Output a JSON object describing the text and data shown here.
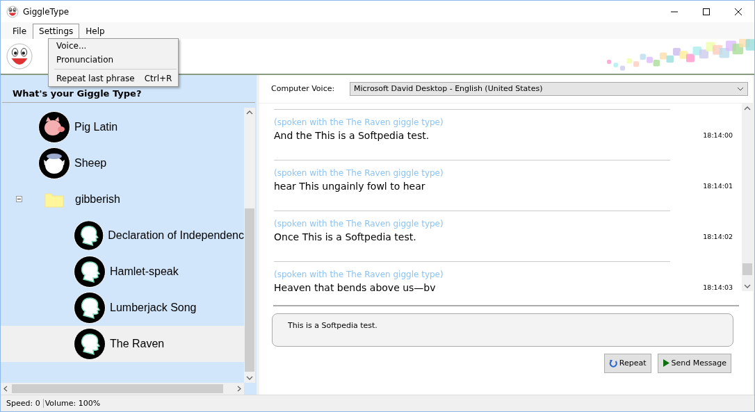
{
  "window": {
    "title": "GiggleType"
  },
  "menu": [
    {
      "label": "File",
      "selected": false
    },
    {
      "label": "Settings",
      "selected": true
    },
    {
      "label": "Help",
      "selected": false
    }
  ],
  "open_menu": [
    {
      "kind": "item",
      "label": "Voice..."
    },
    {
      "kind": "item",
      "label": "Pronunciation"
    },
    {
      "kind": "separator"
    },
    {
      "kind": "item",
      "label": "Repeat last phrase",
      "shortcut": "Ctrl+R"
    }
  ],
  "sidebar": {
    "heading": "What's your Giggle Type?",
    "tree": [
      {
        "kind": "pig",
        "label": "Pig Latin",
        "selected": false
      },
      {
        "kind": "sheep",
        "label": "Sheep",
        "selected": false
      },
      {
        "kind": "folder",
        "label": "gibberish",
        "selected": false,
        "expanded": true,
        "children": [
          {
            "kind": "head",
            "label": "Declaration of Independenc",
            "selected": false
          },
          {
            "kind": "head",
            "label": "Hamlet-speak",
            "selected": false
          },
          {
            "kind": "head",
            "label": "Lumberjack Song",
            "selected": false
          },
          {
            "kind": "head",
            "label": "The Raven",
            "selected": true
          }
        ]
      }
    ]
  },
  "voice": {
    "label": "Computer Voice:",
    "value": "Microsoft David Desktop - English (United States)"
  },
  "messages": [
    {
      "note": "(spoken with the The Raven giggle type)",
      "text": "And the This is a Softpedia test.",
      "time": "18:14:00"
    },
    {
      "note": "(spoken with the The Raven giggle type)",
      "text": "hear This ungainly fowl to hear",
      "time": "18:14:01"
    },
    {
      "note": "(spoken with the The Raven giggle type)",
      "text": "Once This is a Softpedia test.",
      "time": "18:14:02"
    },
    {
      "note": "(spoken with the The Raven giggle type)",
      "text": "Heaven that bends above us—bv",
      "time": "18:14:03"
    }
  ],
  "input": {
    "value": "This is a Softpedia test."
  },
  "buttons": [
    {
      "kind": "repeat",
      "label": "Repeat"
    },
    {
      "kind": "send",
      "label": "Send Message"
    }
  ],
  "status_bar": [
    "Speed: 0",
    "Volume: 100%"
  ]
}
